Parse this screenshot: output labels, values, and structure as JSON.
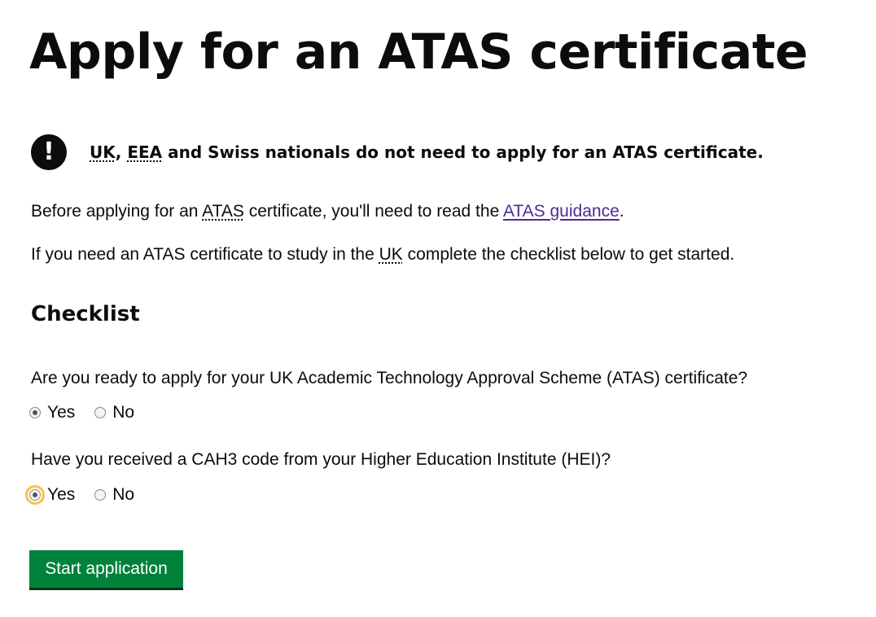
{
  "page": {
    "title": "Apply for an ATAS certificate"
  },
  "warning": {
    "icon": "exclamation-icon",
    "icon_glyph": "!",
    "abbr_uk": "UK",
    "separator": ", ",
    "abbr_eea": "EEA",
    "text_rest": " and Swiss nationals do not need to apply for an ATAS certificate."
  },
  "intro": {
    "p1_before": "Before applying for an ",
    "p1_abbr": "ATAS",
    "p1_middle": " certificate, you'll need to read the ",
    "p1_link": "ATAS guidance",
    "p1_end": ".",
    "p2_before": "If you need an ATAS certificate to study in the ",
    "p2_abbr": "UK",
    "p2_after": " complete the checklist below to get started."
  },
  "checklist": {
    "heading": "Checklist",
    "questions": [
      {
        "question": "Are you ready to apply for your UK Academic Technology Approval Scheme (ATAS) certificate?",
        "options": [
          "Yes",
          "No"
        ],
        "selected": "Yes"
      },
      {
        "question": "Have you received a CAH3 code from your Higher Education Institute (HEI)?",
        "options": [
          "Yes",
          "No"
        ],
        "selected": "Yes"
      }
    ]
  },
  "actions": {
    "start_label": "Start application"
  },
  "colors": {
    "button_green": "#00823b",
    "link_purple": "#4c2c92",
    "focus_yellow": "#ffbf47",
    "text": "#0b0c0c"
  }
}
